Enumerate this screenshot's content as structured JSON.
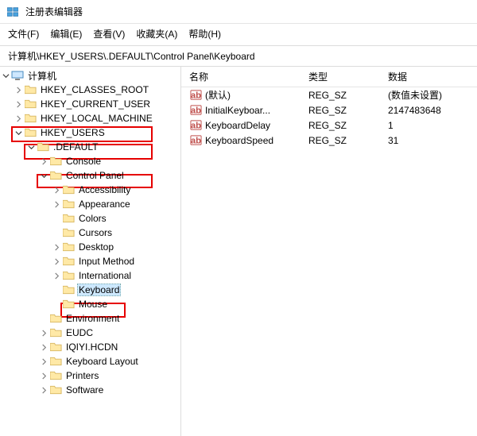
{
  "window": {
    "title": "注册表编辑器"
  },
  "menu": {
    "file": "文件(F)",
    "edit": "编辑(E)",
    "view": "查看(V)",
    "favorites": "收藏夹(A)",
    "help": "帮助(H)"
  },
  "addressbar": {
    "path": "计算机\\HKEY_USERS\\.DEFAULT\\Control Panel\\Keyboard"
  },
  "tree": {
    "root": "计算机",
    "hkcr": "HKEY_CLASSES_ROOT",
    "hkcu": "HKEY_CURRENT_USER",
    "hklm": "HKEY_LOCAL_MACHINE",
    "hku": "HKEY_USERS",
    "default": ".DEFAULT",
    "console": "Console",
    "controlpanel": "Control Panel",
    "accessibility": "Accessibility",
    "appearance": "Appearance",
    "colors": "Colors",
    "cursors": "Cursors",
    "desktop": "Desktop",
    "inputmethod": "Input Method",
    "international": "International",
    "keyboard": "Keyboard",
    "mouse": "Mouse",
    "environment": "Environment",
    "eudc": "EUDC",
    "iqiyi": "IQIYI.HCDN",
    "kblayout": "Keyboard Layout",
    "printers": "Printers",
    "software": "Software"
  },
  "list": {
    "headers": {
      "name": "名称",
      "type": "类型",
      "data": "数据"
    },
    "rows": [
      {
        "name": "(默认)",
        "type": "REG_SZ",
        "data": "(数值未设置)"
      },
      {
        "name": "InitialKeyboar...",
        "type": "REG_SZ",
        "data": "2147483648"
      },
      {
        "name": "KeyboardDelay",
        "type": "REG_SZ",
        "data": "1"
      },
      {
        "name": "KeyboardSpeed",
        "type": "REG_SZ",
        "data": "31"
      }
    ]
  }
}
